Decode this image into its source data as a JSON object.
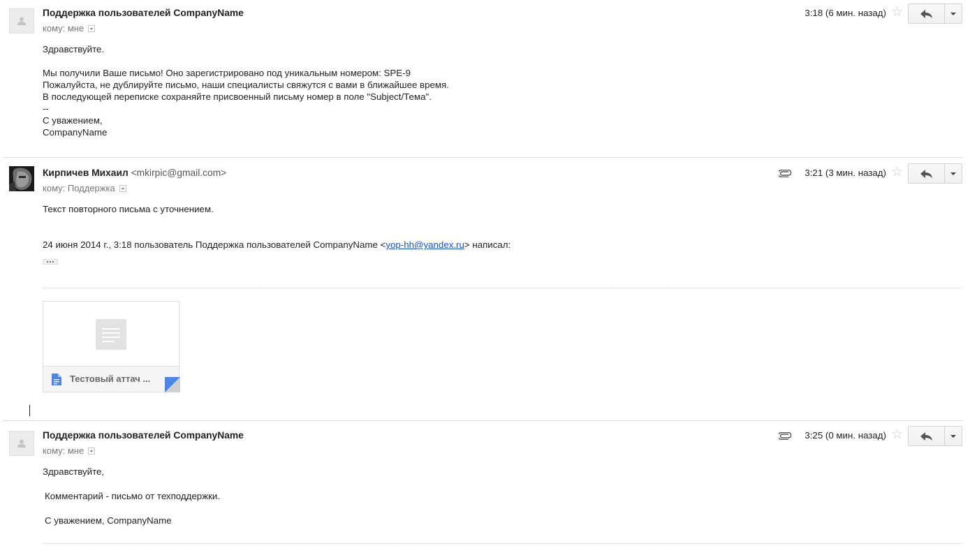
{
  "messages": [
    {
      "sender_name": "Поддержка пользователей CompanyName",
      "sender_email": "",
      "recipient": "кому: мне",
      "time": "3:18 (6 мин. назад)",
      "has_attachment": false,
      "avatar": "default-avatar-icon",
      "body": [
        "Здравствуйте.",
        "",
        "Мы получили Ваше письмо! Оно зарегистрировано под уникальным номером: SPE-9",
        "Пожалуйста, не дублируйте письмо, наши специалисты свяжутся с вами в ближайшее время.",
        "В последующей переписке сохраняйте присвоенный письму номер в поле \"Subject/Тема\".",
        "--",
        "С уважением,",
        "CompanyName"
      ]
    },
    {
      "sender_name": "Кирпичев Михаил",
      "sender_email": "<mkirpic@gmail.com>",
      "recipient": "кому: Поддержка",
      "time": "3:21 (3 мин. назад)",
      "has_attachment": true,
      "avatar": "user-photo",
      "body": [
        "Текст повторного письма с уточнением."
      ],
      "quote": {
        "prefix": "24 июня 2014 г., 3:18 пользователь Поддержка пользователей CompanyName <",
        "email": "yop-hh@yandex.ru",
        "suffix": "> написал:"
      },
      "attachment": {
        "name": "Тестовый аттач ..."
      }
    },
    {
      "sender_name": "Поддержка пользователей CompanyName",
      "sender_email": "",
      "recipient": "кому: мне",
      "time": "3:25 (0 мин. назад)",
      "has_attachment": true,
      "avatar": "default-avatar-icon",
      "body": [
        "Здравствуйте,",
        "Комментарий - письмо от техподдержки.",
        "С уважением, CompanyName"
      ]
    }
  ],
  "icons": {
    "star": "star-icon",
    "reply": "reply-icon",
    "more": "chevron-down-icon",
    "attachment": "paperclip-icon",
    "document": "document-icon"
  },
  "colors": {
    "link": "#1155cc",
    "doc_icon": "#4a86e8"
  }
}
